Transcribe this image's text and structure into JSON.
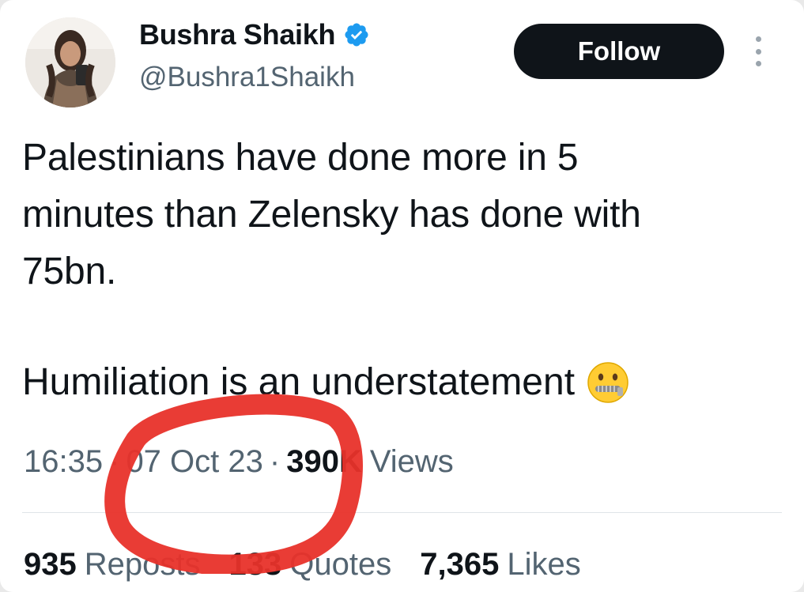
{
  "author": {
    "display_name": "Bushra Shaikh",
    "handle": "@Bushra1Shaikh",
    "avatar_icon": "profile-photo",
    "verified_icon": "verified-badge-icon",
    "verified_color": "#1d9bf0"
  },
  "actions": {
    "follow_label": "Follow",
    "more_icon": "more-vertical-icon"
  },
  "tweet": {
    "line1": "Palestinians have done more in 5",
    "line2": "minutes than Zelensky has done with",
    "line3": "75bn.",
    "line4": "Humiliation is an understatement",
    "emoji_icon": "zipper-mouth-face-emoji"
  },
  "meta": {
    "time": "16:35",
    "separator": "·",
    "date": "07 Oct 23",
    "views_count": "390K",
    "views_label": "Views"
  },
  "stats": {
    "reposts_count": "935",
    "reposts_label": "Reposts",
    "quotes_count": "133",
    "quotes_label": "Quotes",
    "likes_count": "7,365",
    "likes_label": "Likes"
  },
  "colors": {
    "text_primary": "#0f1419",
    "text_secondary": "#536471",
    "follow_bg": "#0f1419",
    "annotation_red": "#e8312a"
  }
}
